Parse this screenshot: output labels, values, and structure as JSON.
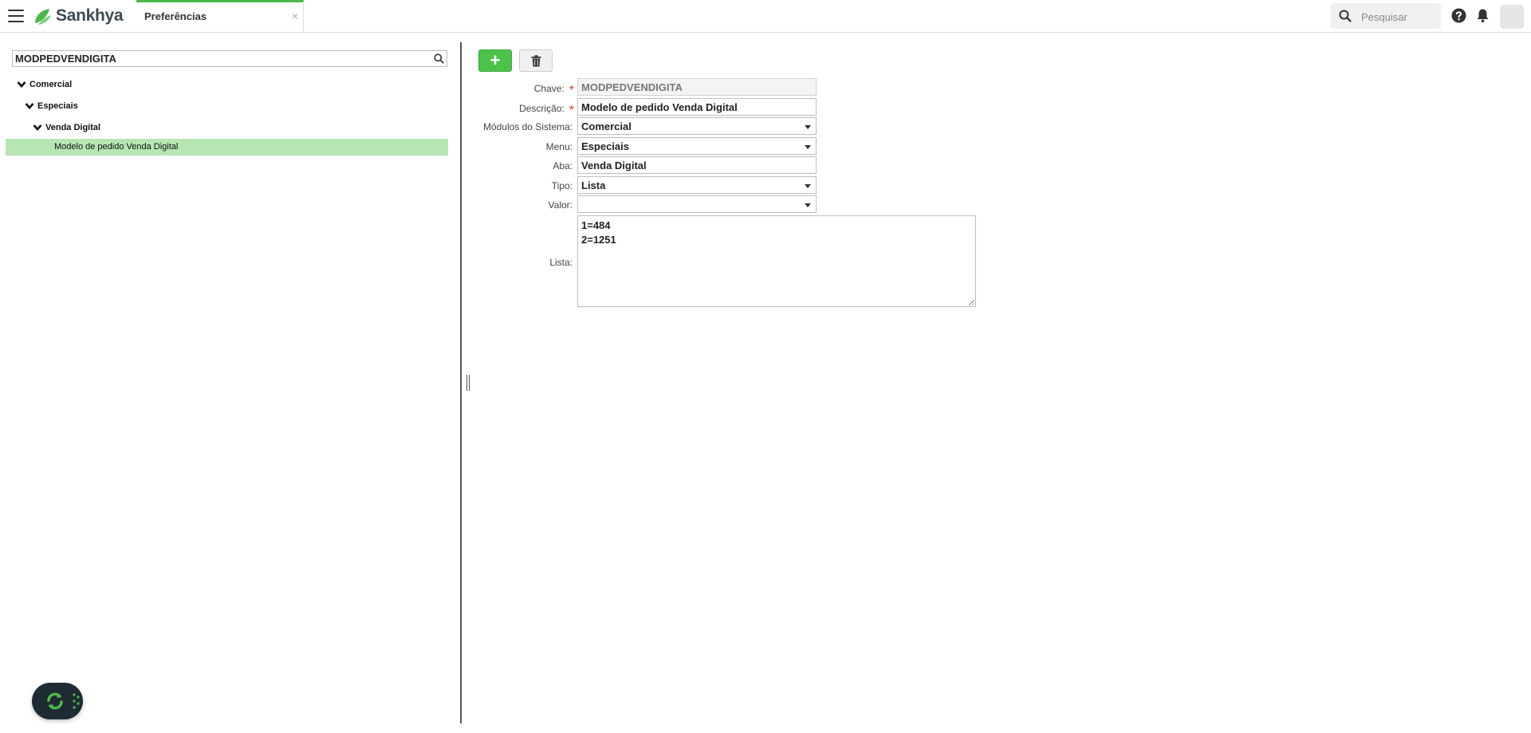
{
  "app": {
    "brand": "Sankhya",
    "brand_color": "#4cb848"
  },
  "tabs": [
    {
      "label": "Preferências",
      "close": "×"
    }
  ],
  "header": {
    "search_placeholder": "Pesquisar",
    "icons": [
      "menu-icon",
      "search-icon",
      "help-icon",
      "bell-icon",
      "avatar"
    ]
  },
  "tree": {
    "search_value": "MODPEDVENDIGITA",
    "nodes": [
      {
        "label": "Comercial",
        "expanded": true,
        "level": 0
      },
      {
        "label": "Especiais",
        "expanded": true,
        "level": 1
      },
      {
        "label": "Venda Digital",
        "expanded": true,
        "level": 2
      }
    ],
    "selected_leaf": "Modelo de pedido Venda Digital",
    "selected_color": "#b6e6b4"
  },
  "form": {
    "toolbar": {
      "add_label": "+",
      "delete_icon": "trash-icon"
    },
    "fields": {
      "chave": {
        "label": "Chave:",
        "value": "MODPEDVENDIGITA",
        "required": "*"
      },
      "descricao": {
        "label": "Descrição:",
        "value": "Modelo de pedido Venda Digital",
        "required": "*"
      },
      "modulos": {
        "label": "Módulos do Sistema:",
        "value": "Comercial"
      },
      "menu": {
        "label": "Menu:",
        "value": "Especiais"
      },
      "aba": {
        "label": "Aba:",
        "value": "Venda Digital"
      },
      "tipo": {
        "label": "Tipo:",
        "value": "Lista"
      },
      "valor": {
        "label": "Valor:",
        "value": ""
      },
      "lista": {
        "label": "Lista:",
        "lines": [
          "1=484",
          "2=1251"
        ]
      }
    }
  }
}
